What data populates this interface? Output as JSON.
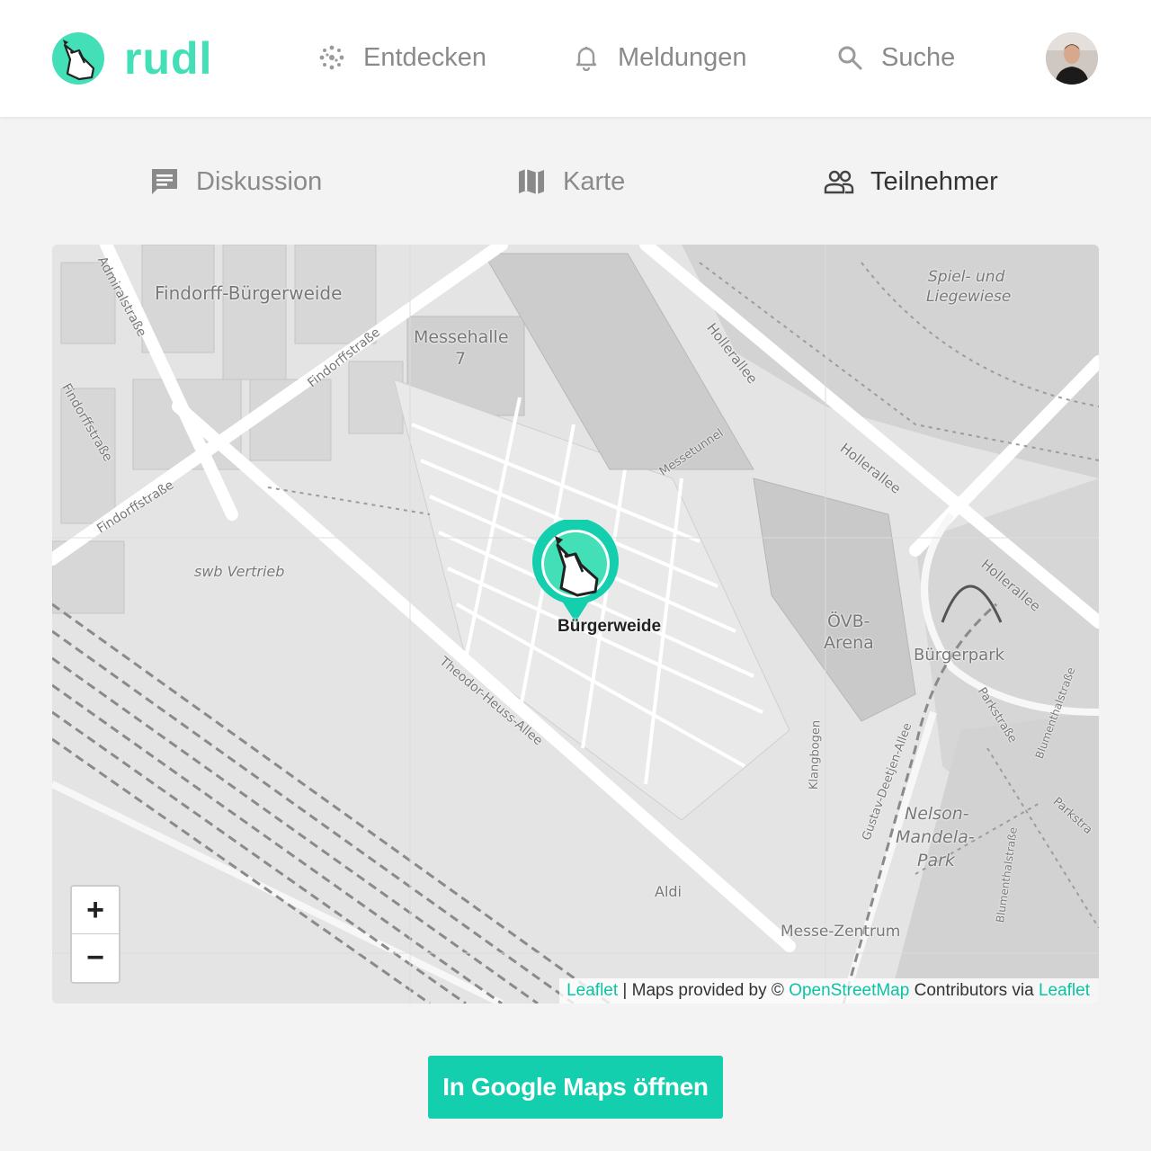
{
  "brand": {
    "name": "rudl",
    "color": "#43dfb6",
    "logo_icon": "wolf-logo-icon"
  },
  "nav": {
    "entdecken": {
      "label": "Entdecken",
      "icon": "dots-grid-icon"
    },
    "meldungen": {
      "label": "Meldungen",
      "icon": "bell-icon"
    },
    "suche": {
      "label": "Suche",
      "icon": "search-icon"
    }
  },
  "user": {
    "avatar_icon": "avatar"
  },
  "tabs": {
    "diskussion": {
      "label": "Diskussion",
      "icon": "chat-icon",
      "active": false
    },
    "karte": {
      "label": "Karte",
      "icon": "map-icon",
      "active": false
    },
    "teilnehmer": {
      "label": "Teilnehmer",
      "icon": "people-icon",
      "active": true
    }
  },
  "map": {
    "marker_label": "Bürgerweide",
    "zoom_in": "+",
    "zoom_out": "−",
    "places": {
      "findorff": "Findorff-Bürgerweide",
      "messehalle": "Messehalle",
      "messehalle_num": "7",
      "spielwiese_1": "Spiel- und",
      "spielwiese_2": "Liegewiese",
      "oevb_1": "ÖVB-",
      "oevb_2": "Arena",
      "buergerpark": "Bürgerpark",
      "swb": "swb Vertrieb",
      "nelson_1": "Nelson-",
      "nelson_2": "Mandela-",
      "nelson_3": "Park",
      "aldi": "Aldi",
      "messezentrum": "Messe-Zentrum"
    },
    "streets": {
      "admiralstrasse": "Admiralstraße",
      "findorffstrasse_1": "Findorffstraße",
      "findorffstrasse_2": "Findorffstraße",
      "findorffstrasse_3": "Findorffstraße",
      "hollerallee_1": "Hollerallee",
      "hollerallee_2": "Hollerallee",
      "hollerallee_3": "Hollerallee",
      "messetunnel": "Messetunnel",
      "theodor": "Theodor-Heuss-Allee",
      "klangbogen": "Klangbogen",
      "gustav": "Gustav-Deetjen-Allee",
      "parkstrasse_1": "Parkstraße",
      "parkstrasse_2": "Parkstra",
      "blumenthal_1": "Blumenthalstraße",
      "blumenthal_2": "Blumenthalstraße"
    },
    "attribution": {
      "leaflet": "Leaflet",
      "text_1": " | Maps provided by © ",
      "osm": "OpenStreetMap",
      "text_2": " Contributors via ",
      "leaflet_2": "Leaflet"
    },
    "accent_color": "#13cfae"
  },
  "actions": {
    "open_gmaps": "In Google Maps öffnen"
  }
}
